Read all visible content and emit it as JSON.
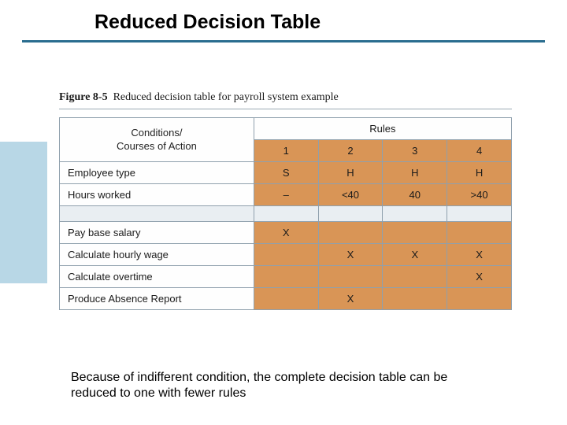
{
  "title": "Reduced Decision Table",
  "figure": {
    "number": "Figure 8-5",
    "desc": "Reduced decision table for payroll system example"
  },
  "table": {
    "conditions_header": "Conditions/\nCourses of Action",
    "rules_header": "Rules",
    "rule_nums": [
      "1",
      "2",
      "3",
      "4"
    ],
    "conditions": [
      {
        "label": "Employee type",
        "cells": [
          "S",
          "H",
          "H",
          "H"
        ]
      },
      {
        "label": "Hours worked",
        "cells": [
          "–",
          "<40",
          "40",
          ">40"
        ]
      }
    ],
    "actions": [
      {
        "label": "Pay base salary",
        "cells": [
          "X",
          "",
          "",
          ""
        ]
      },
      {
        "label": "Calculate hourly wage",
        "cells": [
          "",
          "X",
          "X",
          "X"
        ]
      },
      {
        "label": "Calculate overtime",
        "cells": [
          "",
          "",
          "",
          "X"
        ]
      },
      {
        "label": "Produce Absence Report",
        "cells": [
          "",
          "X",
          "",
          ""
        ]
      }
    ]
  },
  "caption": "Because of indifferent condition, the complete decision table can be reduced to one with fewer rules"
}
